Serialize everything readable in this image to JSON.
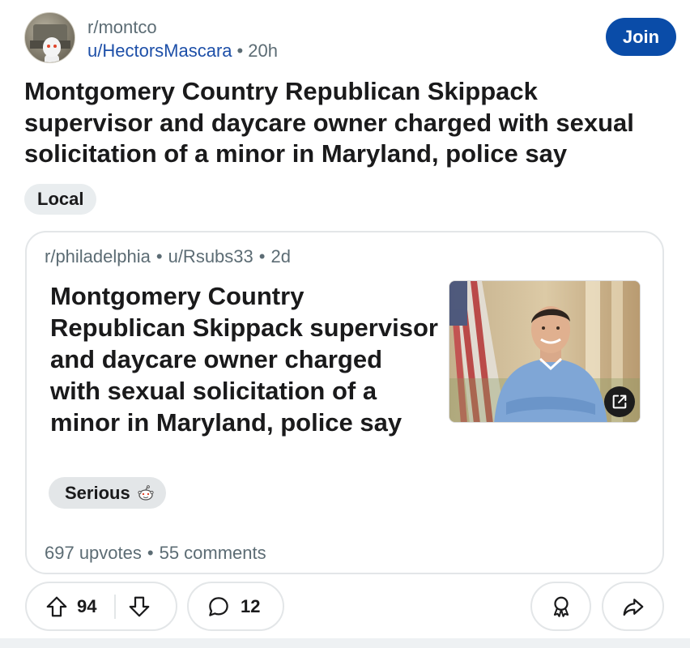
{
  "post": {
    "subreddit": "r/montco",
    "author": "u/HectorsMascara",
    "separator": "•",
    "age": "20h",
    "join_label": "Join",
    "title": "Montgomery Country Republican Skippack supervisor and daycare owner charged with sexual solicitation of a minor in Maryland, police say",
    "flair": "Local"
  },
  "crosspost": {
    "subreddit": "r/philadelphia",
    "author": "u/Rsubs33",
    "age": "2d",
    "title": "Montgomery Country Republican Skippack supervisor and daycare owner charged with sexual solicitation of a minor in Maryland, police say",
    "flair": "Serious",
    "upvotes": "697 upvotes",
    "comments": "55 comments"
  },
  "actions": {
    "score": "94",
    "comment_count": "12"
  },
  "icons": {
    "upvote": "upvote-arrow-icon",
    "downvote": "downvote-arrow-icon",
    "comment": "comment-bubble-icon",
    "award": "award-icon",
    "share": "share-arrow-icon",
    "external_link": "external-link-icon"
  },
  "colors": {
    "join_button": "#0a4ca8",
    "username": "#1d4fa8",
    "muted_text": "#5c6c74",
    "flair_bg": "#e9edef",
    "border": "#e3e6e8"
  }
}
